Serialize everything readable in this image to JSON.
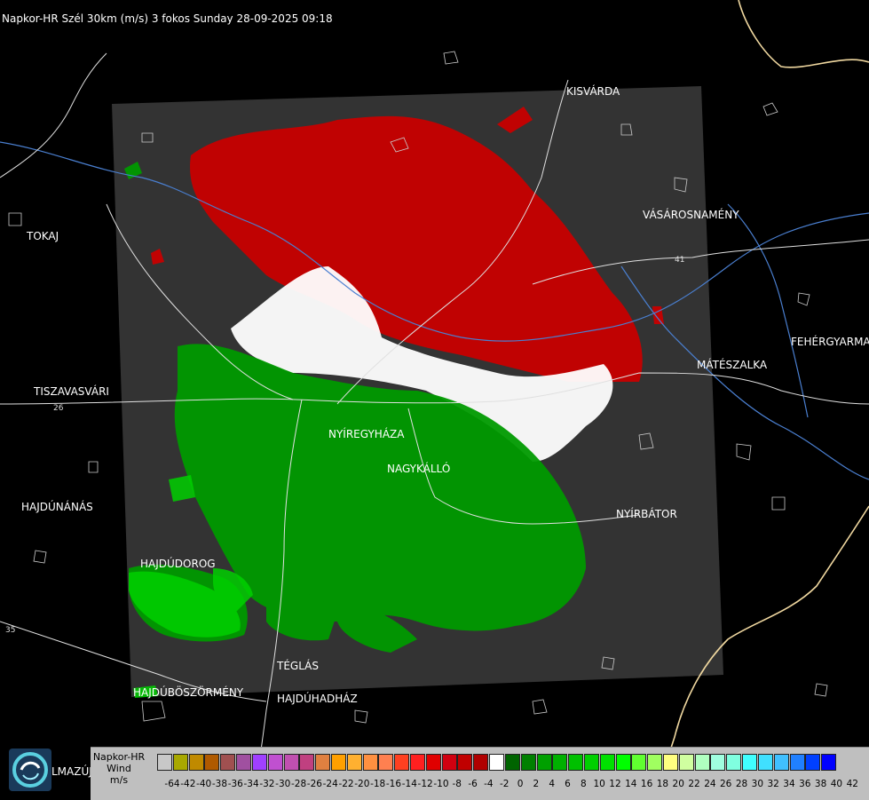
{
  "title": "Napkor-HR Szél 30km (m/s) 3 fokos Sunday 28-09-2025 09:18",
  "cities": [
    {
      "name": "KISVÁRDA"
    },
    {
      "name": "VÁSÁROSNAMÉNY"
    },
    {
      "name": "TOKAJ"
    },
    {
      "name": "FEHÉRGYARMAT"
    },
    {
      "name": "MÁTÉSZALKA"
    },
    {
      "name": "TISZAVASVÁRI"
    },
    {
      "name": "NYÍREGYHÁZA"
    },
    {
      "name": "NAGYKÁLLÓ"
    },
    {
      "name": "HAJDÚNÁNÁS"
    },
    {
      "name": "NYÍRBÁTOR"
    },
    {
      "name": "HAJDÚDOROG"
    },
    {
      "name": "TÉGLÁS"
    },
    {
      "name": "HAJDÚBÖSZÖRMÉNY"
    },
    {
      "name": "HAJDÚHADHÁZ"
    },
    {
      "name": "LMAZÚJVÁR"
    }
  ],
  "road_numbers": [
    "26",
    "35",
    "41"
  ],
  "legend": {
    "line1": "Napkor-HR",
    "line2": "Wind",
    "line3": "m/s",
    "swatch_colors": [
      "#c8c8c8",
      "#a8a800",
      "#c08a00",
      "#b05a00",
      "#a05050",
      "#a050a0",
      "#a040ff",
      "#c050d0",
      "#c050b0",
      "#c04080",
      "#e08040",
      "#ffa000",
      "#ffb030",
      "#ff9040",
      "#ff8050",
      "#ff4020",
      "#ff2020",
      "#e00000",
      "#d00010",
      "#c00000",
      "#b00000",
      "#ffffff",
      "#006400",
      "#008000",
      "#00a000",
      "#00b000",
      "#00c000",
      "#00d000",
      "#00e000",
      "#00ff00",
      "#60ff30",
      "#a0ff60",
      "#ffff80",
      "#d0ffa0",
      "#b0ffc0",
      "#a0ffe0",
      "#80ffe0",
      "#40ffff",
      "#40e0ff",
      "#40c0ff",
      "#2080ff",
      "#0040ff",
      "#0000ff"
    ],
    "tick_labels": [
      "-64",
      "-42",
      "-40",
      "-38",
      "-36",
      "-34",
      "-32",
      "-30",
      "-28",
      "-26",
      "-24",
      "-22",
      "-20",
      "-18",
      "-16",
      "-14",
      "-12",
      "-10",
      "-8",
      "-6",
      "-4",
      "-2",
      "0",
      "2",
      "4",
      "6",
      "8",
      "10",
      "12",
      "14",
      "16",
      "18",
      "20",
      "22",
      "24",
      "26",
      "28",
      "30",
      "32",
      "34",
      "36",
      "38",
      "40",
      "42"
    ]
  }
}
